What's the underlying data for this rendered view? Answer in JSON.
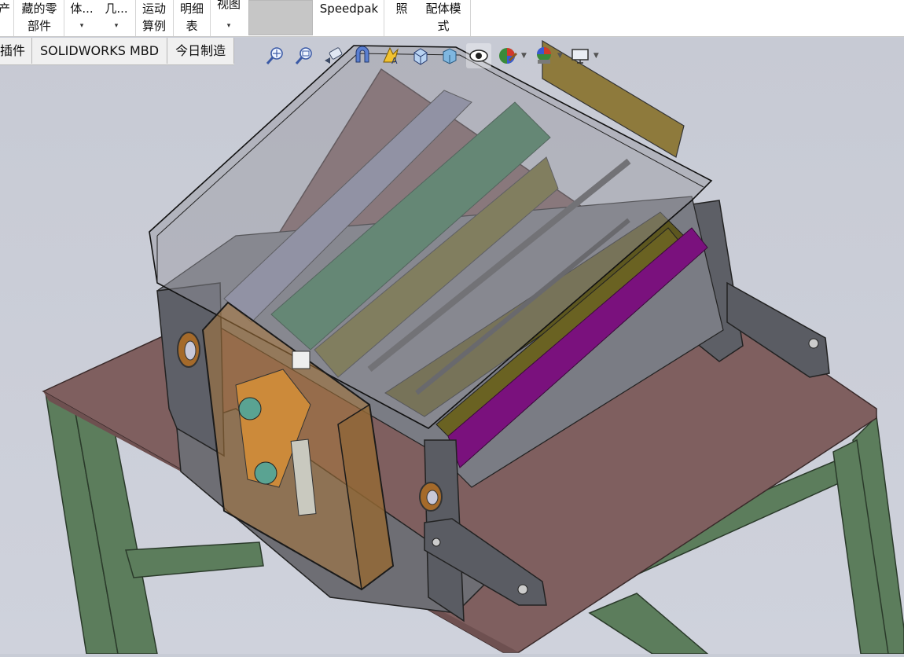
{
  "ribbon": {
    "items": [
      {
        "l1": "藏的零",
        "l2": "部件"
      },
      {
        "l1": "体...",
        "l2": "▾"
      },
      {
        "l1": "几...",
        "l2": "▾"
      },
      {
        "l1": "运动",
        "l2": "算例"
      },
      {
        "l1": "明细",
        "l2": "表"
      },
      {
        "l1": "视图",
        "l2": "▾"
      },
      {
        "l1": "Speedpak",
        "l2": ""
      },
      {
        "l1": "照",
        "l2": ""
      },
      {
        "l1": "配体模",
        "l2": "式"
      }
    ],
    "edge_label": "产"
  },
  "tabs": [
    "插件",
    "SOLIDWORKS MBD",
    "今日制造"
  ],
  "heads_up_toolbar": [
    {
      "icon": "zoom-to-fit-icon"
    },
    {
      "icon": "zoom-to-area-icon"
    },
    {
      "icon": "previous-view-icon"
    },
    {
      "icon": "section-view-icon"
    },
    {
      "icon": "dynamic-annotation-views-icon"
    },
    {
      "icon": "view-orientation-icon"
    },
    {
      "icon": "display-style-icon"
    },
    {
      "icon": "hide-show-items-icon"
    },
    {
      "icon": "edit-appearance-icon"
    },
    {
      "icon": "apply-scene-icon"
    },
    {
      "icon": "view-settings-icon"
    }
  ],
  "colors": {
    "viewport_bg": "#c8ccd6",
    "table_top": "#7f5f5f",
    "table_frame": "#5c7d5c",
    "green_roller": "#3c7a52",
    "purple_roller": "#7a117d",
    "olive_roller": "#6f6a2a",
    "lavender_roller": "#8c8ea8",
    "orange_panel": "#a9773a"
  }
}
